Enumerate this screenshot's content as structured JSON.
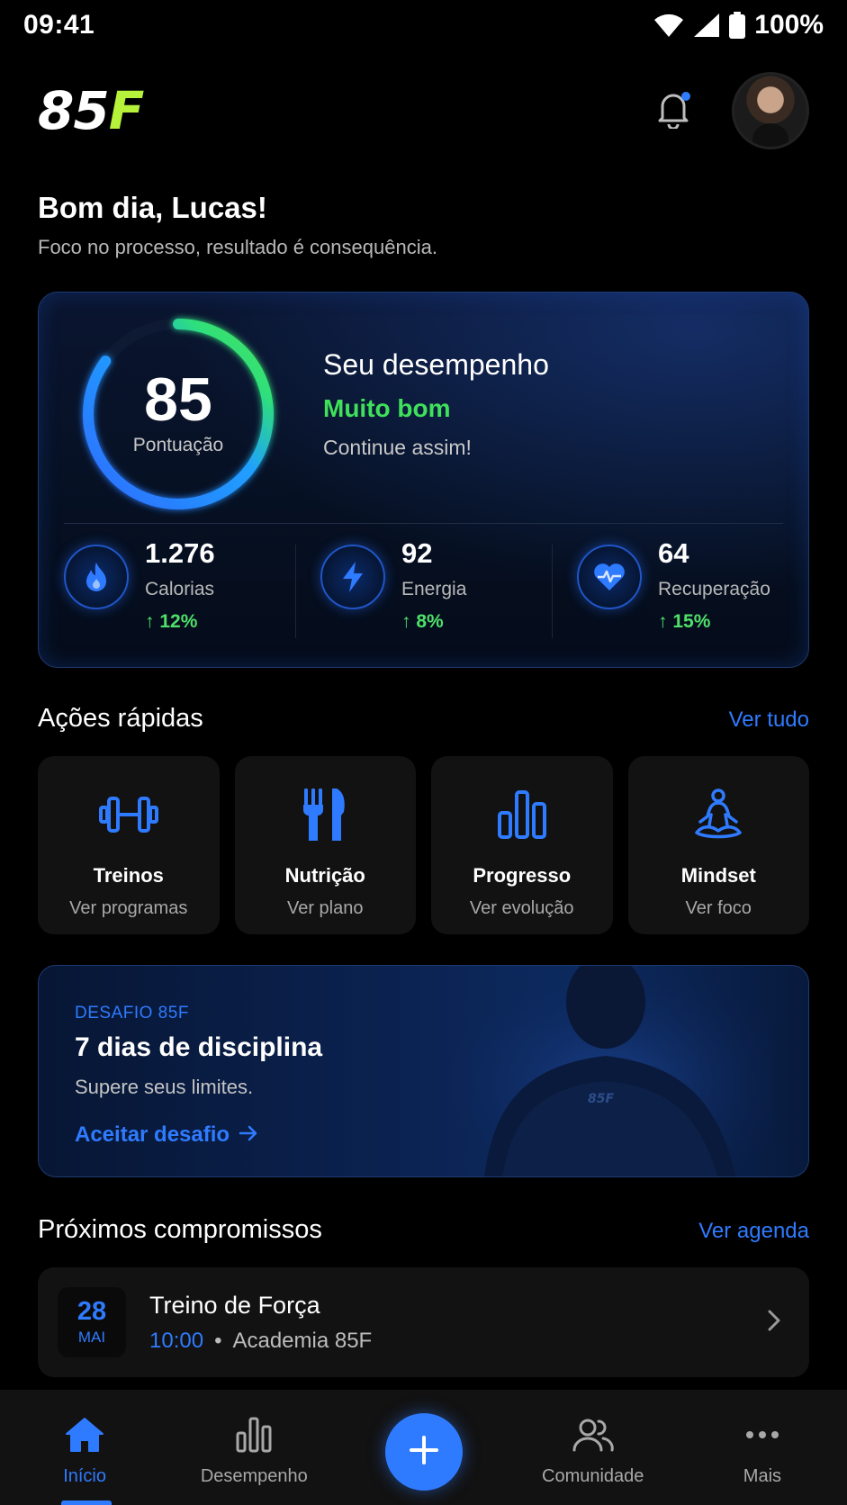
{
  "status_bar": {
    "time": "09:41",
    "battery": "100%"
  },
  "header": {
    "logo_part1": "85",
    "logo_part2": "F"
  },
  "greeting": {
    "title": "Bom dia, Lucas!",
    "subtitle": "Foco no processo, resultado é consequência."
  },
  "performance": {
    "score": "85",
    "score_label": "Pontuação",
    "score_fraction": 0.85,
    "title": "Seu desempenho",
    "status": "Muito bom",
    "note": "Continue assim!",
    "stats": [
      {
        "icon": "flame-icon",
        "value": "1.276",
        "label": "Calorias",
        "change": "↑ 12%"
      },
      {
        "icon": "lightning-icon",
        "value": "92",
        "label": "Energia",
        "change": "↑ 8%"
      },
      {
        "icon": "heart-pulse-icon",
        "value": "64",
        "label": "Recuperação",
        "change": "↑ 15%"
      }
    ]
  },
  "quick_actions": {
    "title": "Ações rápidas",
    "link": "Ver tudo",
    "items": [
      {
        "icon": "dumbbell-icon",
        "title": "Treinos",
        "subtitle": "Ver programas"
      },
      {
        "icon": "fork-knife-icon",
        "title": "Nutrição",
        "subtitle": "Ver plano"
      },
      {
        "icon": "bar-chart-icon",
        "title": "Progresso",
        "subtitle": "Ver evolução"
      },
      {
        "icon": "meditation-icon",
        "title": "Mindset",
        "subtitle": "Ver foco"
      }
    ]
  },
  "challenge": {
    "tag": "DESAFIO 85F",
    "title": "7 dias de disciplina",
    "subtitle": "Supere seus limites.",
    "cta": "Aceitar desafio",
    "shirt_logo": "85F"
  },
  "appointments": {
    "title": "Próximos compromissos",
    "link": "Ver agenda",
    "items": [
      {
        "day": "28",
        "month": "MAI",
        "title": "Treino de Força",
        "time": "10:00",
        "separator": "•",
        "place": "Academia 85F"
      }
    ]
  },
  "bottom_nav": {
    "items": [
      {
        "icon": "home-icon",
        "label": "Início",
        "active": true
      },
      {
        "icon": "bar-chart-icon",
        "label": "Desempenho",
        "active": false
      },
      {
        "icon": "plus-icon",
        "label": "",
        "active": false
      },
      {
        "icon": "users-icon",
        "label": "Comunidade",
        "active": false
      },
      {
        "icon": "more-icon",
        "label": "Mais",
        "active": false
      }
    ]
  },
  "colors": {
    "accent": "#2f7bff",
    "positive": "#3fe05a",
    "logo_green": "#b6f23a",
    "background": "#000000",
    "card": "#121212"
  }
}
